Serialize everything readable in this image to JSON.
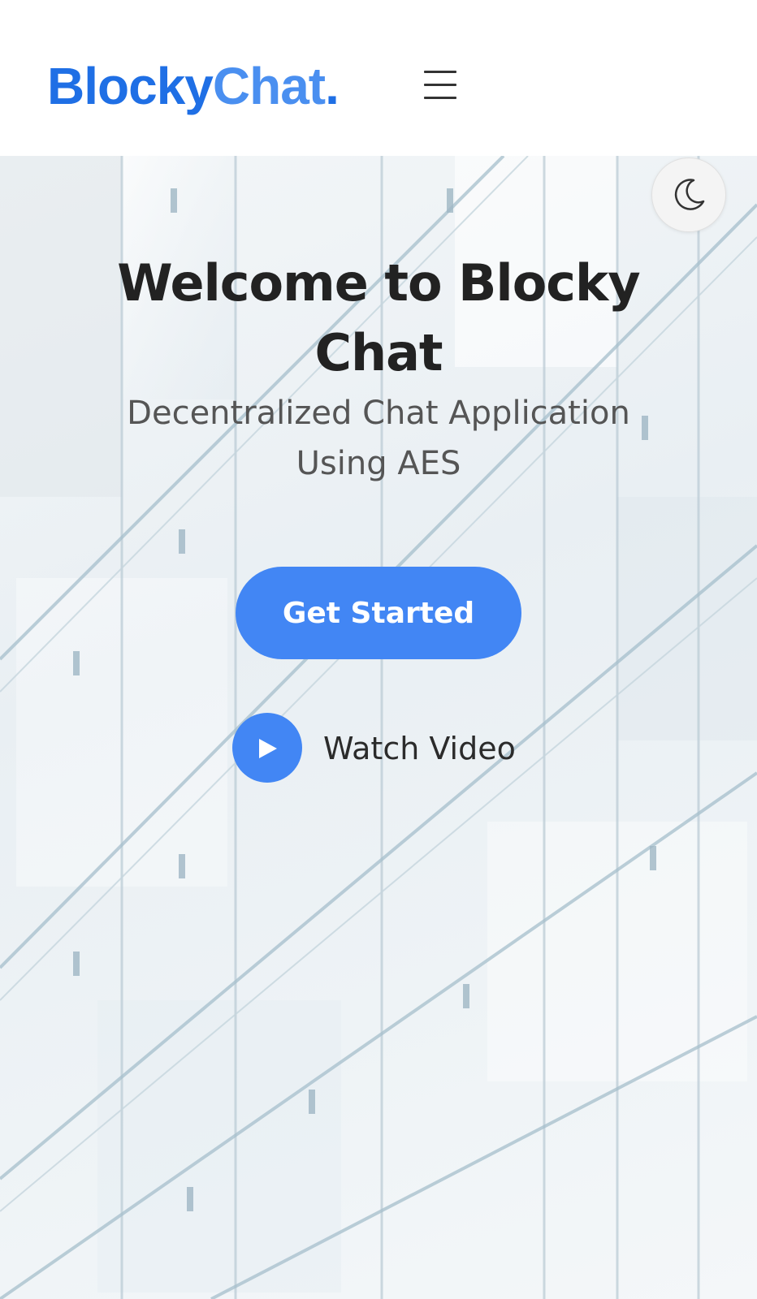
{
  "header": {
    "logo": {
      "part1": "Blocky",
      "part2": "Chat",
      "dot": "."
    },
    "menu_icon": "hamburger-menu-icon"
  },
  "theme_toggle": {
    "icon": "moon-icon"
  },
  "hero": {
    "title": "Welcome to Blocky Chat",
    "subtitle": "Decentralized Chat Application Using AES",
    "cta_label": "Get Started",
    "watch_label": "Watch Video",
    "play_icon": "play-icon"
  },
  "colors": {
    "brand_primary": "#1f6fe5",
    "brand_secondary": "#4a8ff0",
    "button": "#4286f4",
    "title_text": "#222222",
    "subtitle_text": "#555555"
  }
}
